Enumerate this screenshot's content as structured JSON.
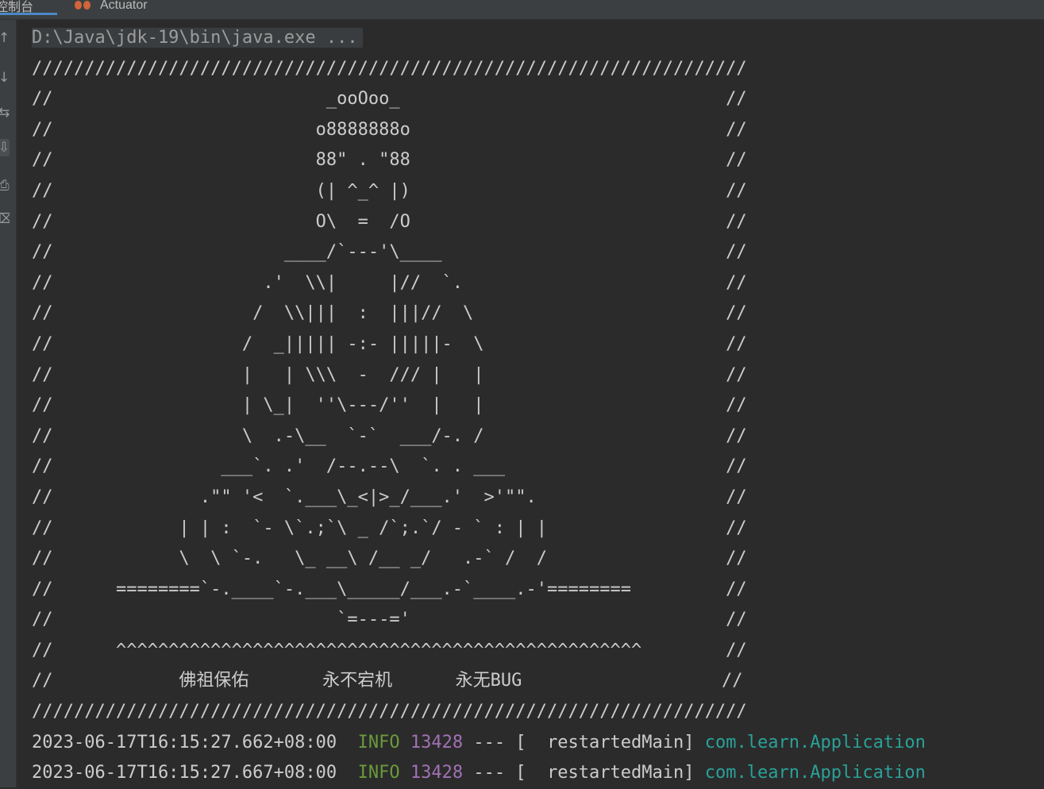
{
  "tabs": [
    {
      "label": "控制台"
    },
    {
      "label": "Actuator"
    }
  ],
  "gutter_icons": [
    "up-arrow-icon",
    "down-arrow-icon",
    "soft-wrap-icon",
    "scroll-to-end-icon",
    "print-icon",
    "trash-icon"
  ],
  "console": {
    "command": "D:\\Java\\jdk-19\\bin\\java.exe ...",
    "banner": [
      "////////////////////////////////////////////////////////////////////",
      "//                          _ooOoo_                               //",
      "//                         o8888888o                              //",
      "//                         88\" . \"88                              //",
      "//                         (| ^_^ |)                              //",
      "//                         O\\  =  /O                              //",
      "//                      ____/`---'\\____                           //",
      "//                    .'  \\\\|     |//  `.                         //",
      "//                   /  \\\\|||  :  |||//  \\                        //",
      "//                  /  _||||| -:- |||||-  \\                       //",
      "//                  |   | \\\\\\  -  /// |   |                       //",
      "//                  | \\_|  ''\\---/''  |   |                       //",
      "//                  \\  .-\\__  `-`  ___/-. /                       //",
      "//                ___`. .'  /--.--\\  `. . ___                     //",
      "//              .\"\" '<  `.___\\_<|>_/___.'  >'\"\".                  //",
      "//            | | :  `- \\`.;`\\ _ /`;.`/ - ` : | |                 //",
      "//            \\  \\ `-.   \\_ __\\ /__ _/   .-` /  /                 //",
      "//      ========`-.____`-.___\\_____/___.-`____.-'========         //",
      "//                           `=---='                              //",
      "//      ^^^^^^^^^^^^^^^^^^^^^^^^^^^^^^^^^^^^^^^^^^^^^^^^^^        //",
      "//            佛祖保佑       永不宕机      永无BUG                   //",
      "////////////////////////////////////////////////////////////////////"
    ],
    "logs": [
      {
        "timestamp": "2023-06-17T16:15:27.662+08:00",
        "level": "INFO",
        "pid": "13428",
        "sep": "---",
        "thread": "[  restartedMain]",
        "logger": "com.learn.Application"
      },
      {
        "timestamp": "2023-06-17T16:15:27.667+08:00",
        "level": "INFO",
        "pid": "13428",
        "sep": "---",
        "thread": "[  restartedMain]",
        "logger": "com.learn.Application"
      }
    ]
  }
}
